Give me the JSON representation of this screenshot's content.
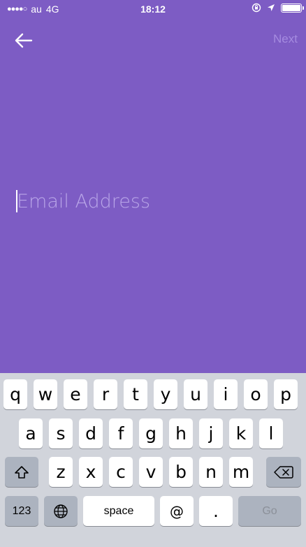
{
  "status_bar": {
    "carrier": "au",
    "network": "4G",
    "time": "18:12"
  },
  "nav": {
    "back_icon": "arrow-left-icon",
    "next_label": "Next"
  },
  "email": {
    "placeholder": "Email Address",
    "value": ""
  },
  "keyboard": {
    "row1": [
      "q",
      "w",
      "e",
      "r",
      "t",
      "y",
      "u",
      "i",
      "o",
      "p"
    ],
    "row2": [
      "a",
      "s",
      "d",
      "f",
      "g",
      "h",
      "j",
      "k",
      "l"
    ],
    "row3": [
      "z",
      "x",
      "c",
      "v",
      "b",
      "n",
      "m"
    ],
    "shift_icon": "shift-icon",
    "delete_icon": "backspace-icon",
    "numbers_label": "123",
    "globe_icon": "globe-icon",
    "space_label": "space",
    "at_label": "@",
    "dot_label": ".",
    "go_label": "Go"
  },
  "colors": {
    "background": "#7d5cc4",
    "next_disabled": "#a58be0",
    "keyboard_bg": "#d1d4db"
  }
}
